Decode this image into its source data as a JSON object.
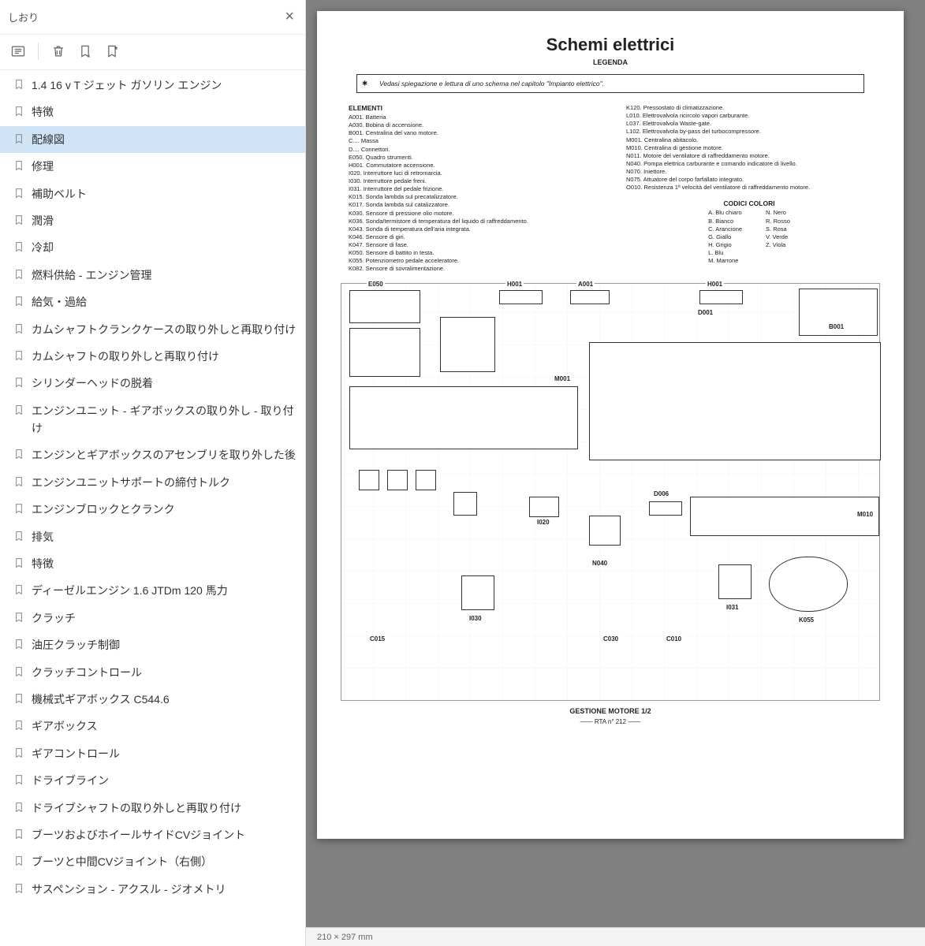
{
  "sidebar": {
    "title": "しおり",
    "items": [
      "1.4 16 v  T ジェット ガソリン エンジン",
      "特徴",
      "配線図",
      "修理",
      "補助ベルト",
      "潤滑",
      "冷却",
      "燃料供給 - エンジン管理",
      "給気・過給",
      "カムシャフトクランクケースの取り外しと再取り付け",
      "カムシャフトの取り外しと再取り付け",
      "シリンダーヘッドの脱着",
      "エンジンユニット - ギアボックスの取り外し - 取り付け",
      "エンジンとギアボックスのアセンブリを取り外した後",
      "エンジンユニットサポートの締付トルク",
      "エンジンブロックとクランク",
      "排気",
      "特徴",
      "ディーゼルエンジン 1.6 JTDm 120 馬力",
      "クラッチ",
      "油圧クラッチ制御",
      "クラッチコントロール",
      "機械式ギアボックス C544.6",
      "ギアボックス",
      "ギアコントロール",
      "ドライブライン",
      "ドライブシャフトの取り外しと再取り付け",
      "ブーツおよびホイールサイドCVジョイント",
      "ブーツと中間CVジョイント（右側）",
      "サスペンション - アクスル - ジオメトリ"
    ],
    "selected": 2
  },
  "doc": {
    "title": "Schemi elettrici",
    "legendTitle": "LEGENDA",
    "legendBox": "Vedasi spiegazione e lettura di uno schema nel capitolo \"Impianto elettrico\".",
    "elementiTitle": "ELEMENTI",
    "elementiLeft": "A001. Batteria\nA030. Bobina di accensione.\nB001. Centralina del vano motore.\nC.... Massa\nD.... Connettori.\nE050. Quadro strumenti.\nH001. Commutatore accensione.\nI020. Interruttore luci di retromarcia.\nI030. Interruttore pedale freni.\nI031. Interruttore del pedale frizione.\nK015. Sonda lambda sul precatalizzatore.\nK017. Sonda lambda sul catalizzatore.\nK030. Sensore di pressione olio motore.\nK036. Sonda/termistore di temperatura del liquido di raffreddamento.\nK043. Sonda di temperatura dell'aria integrata.\nK046. Sensore di giri.\nK047. Sensore di fase.\nK050. Sensore di battito in testa.\nK055. Potenziometro pedale acceleratore.\nK082. Sensore di sovralimentazione.",
    "elementiRight": "K120. Pressostato di climatizzazione.\nL010. Elettrovalvola ricircolo vapori carburante.\nL037. Elettrovalvola Waste-gate.\nL102. Elettrovalvola by-pass del turbocompressore.\nM001. Centralina abitacolo.\nM010. Centralina di gestione motore.\nN011. Motore del ventilatore di raffreddamento motore.\nN040. Pompa elettrica carburante e comando indicatore di livello.\nN070. Iniettore.\nN075. Attuatore del corpo farfallato integrato.\nO010. Resistenza 1ª velocità del ventilatore di raffreddamento motore.",
    "colorsTitle": "CODICI COLORI",
    "colorsL": "A. Blu chiaro\nB. Bianco\nC. Arancione\nG. Giallo\nH. Grigio\nL. Blu\nM. Marrone",
    "colorsR": "N. Nero\nR. Rosso\nS. Rosa\nV. Verde\nZ. Viola",
    "diag": {
      "E050": "E050",
      "H001a": "H001",
      "A001": "A001",
      "H001b": "H001",
      "D001": "D001",
      "B001": "B001",
      "M001": "M001",
      "D006": "D006",
      "M010": "M010",
      "I020": "I020",
      "I030": "I030",
      "I031": "I031",
      "N040": "N040",
      "C015": "C015",
      "C030": "C030",
      "C010": "C010",
      "K055": "K055",
      "caption": "GESTIONE MOTORE 1/2",
      "foot": "—— RTA n° 212 ——"
    }
  },
  "status": "210 × 297 mm"
}
